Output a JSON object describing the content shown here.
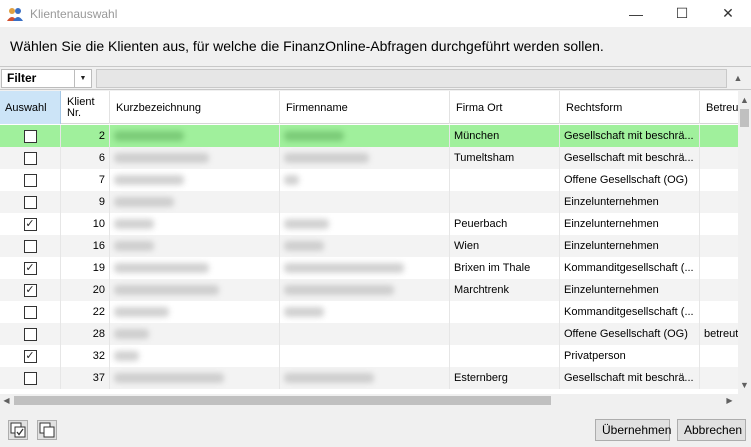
{
  "window": {
    "title": "Klientenauswahl",
    "minimize_glyph": "—",
    "maximize_glyph": "☐",
    "close_glyph": "✕"
  },
  "instruction": "Wählen Sie die Klienten aus, für welche die FinanzOnline-Abfragen durchgeführt werden sollen.",
  "filter": {
    "label": "Filter",
    "dropdown_glyph": "▼",
    "collapse_glyph": "▲"
  },
  "columns": {
    "auswahl": "Auswahl",
    "klient_nr_line1": "Klient",
    "klient_nr_line2": "Nr.",
    "kurzbezeichnung": "Kurzbezeichnung",
    "firmenname": "Firmenname",
    "firma_ort": "Firma Ort",
    "rechtsform": "Rechtsform",
    "betreuer": "Betreu"
  },
  "rows": [
    {
      "checked": false,
      "nr": "2",
      "ort": "München",
      "rechtsform": "Gesellschaft mit beschrä...",
      "betreuer": "",
      "selected": true
    },
    {
      "checked": false,
      "nr": "6",
      "ort": "Tumeltsham",
      "rechtsform": "Gesellschaft mit beschrä...",
      "betreuer": ""
    },
    {
      "checked": false,
      "nr": "7",
      "ort": "",
      "rechtsform": "Offene Gesellschaft (OG)",
      "betreuer": ""
    },
    {
      "checked": false,
      "nr": "9",
      "ort": "",
      "rechtsform": "Einzelunternehmen",
      "betreuer": ""
    },
    {
      "checked": true,
      "nr": "10",
      "ort": "Peuerbach",
      "rechtsform": "Einzelunternehmen",
      "betreuer": ""
    },
    {
      "checked": false,
      "nr": "16",
      "ort": "Wien",
      "rechtsform": "Einzelunternehmen",
      "betreuer": ""
    },
    {
      "checked": true,
      "nr": "19",
      "ort": "Brixen im Thale",
      "rechtsform": "Kommanditgesellschaft (...",
      "betreuer": ""
    },
    {
      "checked": true,
      "nr": "20",
      "ort": "Marchtrenk",
      "rechtsform": "Einzelunternehmen",
      "betreuer": ""
    },
    {
      "checked": false,
      "nr": "22",
      "ort": "",
      "rechtsform": "Kommanditgesellschaft (...",
      "betreuer": ""
    },
    {
      "checked": false,
      "nr": "28",
      "ort": "",
      "rechtsform": "Offene Gesellschaft (OG)",
      "betreuer": "betreut"
    },
    {
      "checked": true,
      "nr": "32",
      "ort": "",
      "rechtsform": "Privatperson",
      "betreuer": ""
    },
    {
      "checked": false,
      "nr": "37",
      "ort": "Esternberg",
      "rechtsform": "Gesellschaft mit beschrä...",
      "betreuer": ""
    }
  ],
  "buttons": {
    "uebernehmen": "Übernehmen",
    "abbrechen": "Abbrechen"
  },
  "icons": {
    "select_all": "select-all-icon",
    "deselect_all": "deselect-all-icon",
    "app": "people-icon"
  },
  "colors": {
    "selected_row": "#a0f09c",
    "header_active": "#cce4f7"
  }
}
